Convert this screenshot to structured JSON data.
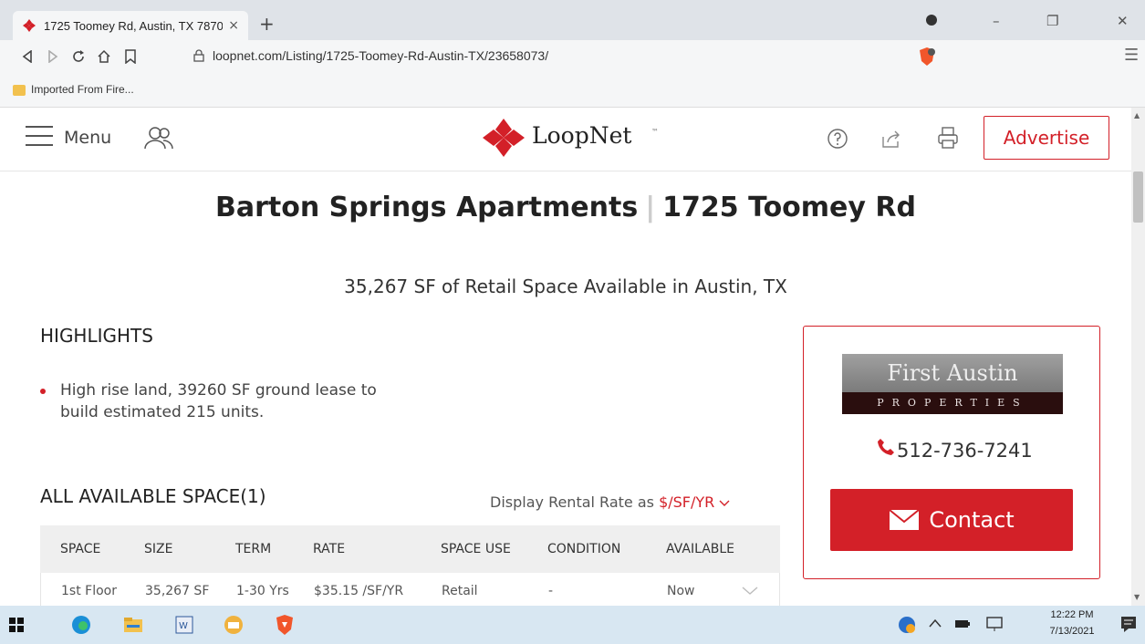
{
  "browser": {
    "tab_title": "1725 Toomey Rd, Austin, TX 7870",
    "tab_close": "×",
    "new_tab": "+",
    "url": "loopnet.com/Listing/1725-Toomey-Rd-Austin-TX/23658073/",
    "bookmark_folder": "Imported From Fire...",
    "win_min": "–",
    "win_max": "❐",
    "win_close": "✕"
  },
  "header": {
    "menu_label": "Menu",
    "logo_text": "LoopNet",
    "logo_tm": "™",
    "advertise_label": "Advertise"
  },
  "listing": {
    "title_name": "Barton Springs Apartments",
    "title_sep": "|",
    "title_address": "1725 Toomey Rd",
    "subtitle": "35,267 SF of Retail Space Available in Austin, TX"
  },
  "highlights": {
    "heading": "HIGHLIGHTS",
    "items": [
      "High rise land, 39260 SF ground lease to build estimated 215 units."
    ]
  },
  "spaces": {
    "heading": "ALL AVAILABLE SPACE(1)",
    "rate_prefix": "Display Rental Rate as",
    "rate_unit": "$/SF/YR",
    "columns": [
      "SPACE",
      "SIZE",
      "TERM",
      "RATE",
      "SPACE USE",
      "CONDITION",
      "AVAILABLE"
    ],
    "rows": [
      [
        "1st Floor",
        "35,267 SF",
        "1-30 Yrs",
        "$35.15 /SF/YR",
        "Retail",
        "-",
        "Now"
      ]
    ]
  },
  "contact": {
    "broker_line1": "First Austin",
    "broker_line2": "PROPERTIES",
    "phone": "512-736-7241",
    "button_label": "Contact"
  },
  "taskbar": {
    "time": "12:22 PM",
    "date": "7/13/2021"
  },
  "colors": {
    "brand_red": "#d32028"
  }
}
